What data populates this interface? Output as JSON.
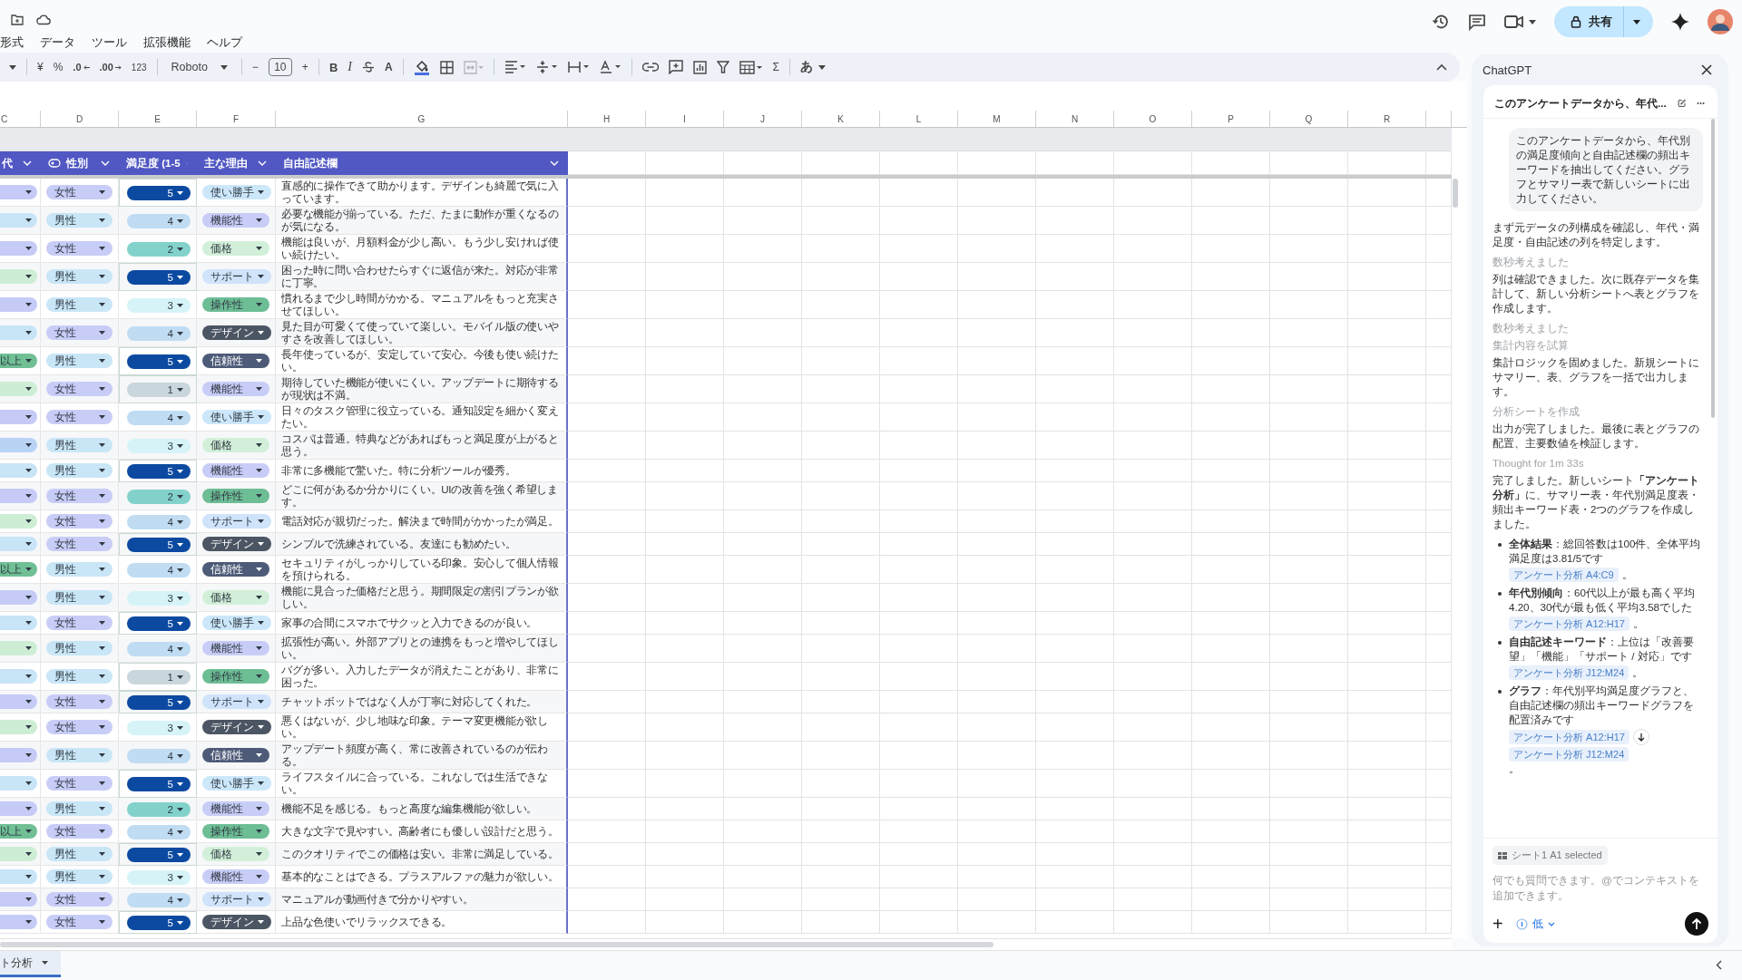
{
  "menu": [
    "形式",
    "データ",
    "ツール",
    "拡張機能",
    "ヘルプ"
  ],
  "toolbar": {
    "currency": "¥",
    "percent": "%",
    "decimal_decrease": ".0",
    "decimal_increase": ".00",
    "number_format": "123",
    "font": "Roboto",
    "font_size_minus": "−",
    "font_size": "10",
    "font_size_plus": "+",
    "bold": "B",
    "italic": "I",
    "text_color": "A",
    "sum": "Σ",
    "input_mode": "あ",
    "merge_disabled": true
  },
  "share": {
    "label": "共有"
  },
  "columns": [
    "C",
    "D",
    "E",
    "F",
    "G",
    "H",
    "I",
    "J",
    "K",
    "L",
    "M",
    "N",
    "O",
    "P",
    "Q",
    "R"
  ],
  "table": {
    "headers": [
      {
        "label": "代",
        "kind": "dropdown"
      },
      {
        "label": "性別",
        "kind": "chip"
      },
      {
        "label": "満足度 (1-5",
        "kind": "dropdown"
      },
      {
        "label": "主な理由",
        "kind": "dropdown"
      },
      {
        "label": "自由記述欄",
        "kind": "dropdown"
      }
    ],
    "rows": [
      {
        "age": {
          "color": "#c5cbf6"
        },
        "gender": {
          "text": "女性",
          "color": "#c8cdf7"
        },
        "score": {
          "text": "5",
          "color": "#0b4aa0",
          "outlined": true
        },
        "reason": {
          "text": "使い勝手",
          "color": "#cce7fa"
        },
        "comment": "直感的に操作できて助かります。デザインも綺麗で気に入っています。"
      },
      {
        "age": {
          "color": "#c8e4f7"
        },
        "gender": {
          "text": "男性",
          "color": "#c9e6f7"
        },
        "score": {
          "text": "4",
          "color": "#c0dcf3",
          "outlined": false
        },
        "reason": {
          "text": "機能性",
          "color": "#c8cdf7"
        },
        "comment": "必要な機能が揃っている。ただ、たまに動作が重くなるのが気になる。"
      },
      {
        "age": {
          "color": "#c5cbf6"
        },
        "gender": {
          "text": "女性",
          "color": "#c8cdf7"
        },
        "score": {
          "text": "2",
          "color": "#82d2cb",
          "outlined": false
        },
        "reason": {
          "text": "価格",
          "color": "#d2f0d9"
        },
        "comment": "機能は良いが、月額料金が少し高い。もう少し安ければ使い続けたい。"
      },
      {
        "age": {
          "color": "#cdeed5"
        },
        "gender": {
          "text": "男性",
          "color": "#c9e6f7"
        },
        "score": {
          "text": "5",
          "color": "#0b4aa0",
          "outlined": true
        },
        "reason": {
          "text": "サポート",
          "color": "#cfe3fa"
        },
        "comment": "困った時に問い合わせたらすぐに返信が来た。対応が非常に丁寧。"
      },
      {
        "age": {
          "color": "#c5cbf6"
        },
        "gender": {
          "text": "男性",
          "color": "#c9e6f7"
        },
        "score": {
          "text": "3",
          "color": "#d6f4f8",
          "outlined": false
        },
        "reason": {
          "text": "操作性",
          "color": "#6dbd95"
        },
        "comment": "慣れるまで少し時間がかかる。マニュアルをもっと充実させてほしい。"
      },
      {
        "age": {
          "color": "#c8e4f7"
        },
        "gender": {
          "text": "女性",
          "color": "#c8cdf7"
        },
        "score": {
          "text": "4",
          "color": "#c0dcf3",
          "outlined": false
        },
        "reason": {
          "text": "デザイン",
          "color": "#4b5563"
        },
        "comment": "見た目が可愛くて使っていて楽しい。モバイル版の使いやすさを改善してほしい。"
      },
      {
        "age": {
          "text": "以上",
          "color": "#70bf95"
        },
        "gender": {
          "text": "男性",
          "color": "#c9e6f7"
        },
        "score": {
          "text": "5",
          "color": "#0b4aa0",
          "outlined": true
        },
        "reason": {
          "text": "信頼性",
          "color": "#4d5b78"
        },
        "comment": "長年使っているが、安定していて安心。今後も使い続けたい。"
      },
      {
        "age": {
          "color": "#cdeed5"
        },
        "gender": {
          "text": "女性",
          "color": "#c8cdf7"
        },
        "score": {
          "text": "1",
          "color": "#c9d6dc",
          "outlined": true
        },
        "reason": {
          "text": "機能性",
          "color": "#c8cdf7"
        },
        "comment": "期待していた機能が使いにくい。アップデートに期待するが現状は不満。"
      },
      {
        "age": {
          "color": "#c5cbf6"
        },
        "gender": {
          "text": "女性",
          "color": "#c8cdf7"
        },
        "score": {
          "text": "4",
          "color": "#c0dcf3",
          "outlined": false
        },
        "reason": {
          "text": "使い勝手",
          "color": "#cce7fa"
        },
        "comment": "日々のタスク管理に役立っている。通知設定を細かく変えたい。"
      },
      {
        "age": {
          "color": "#b9d3f5"
        },
        "gender": {
          "text": "男性",
          "color": "#c9e6f7"
        },
        "score": {
          "text": "3",
          "color": "#d6f4f8",
          "outlined": false
        },
        "reason": {
          "text": "価格",
          "color": "#d2f0d9"
        },
        "comment": "コスパは普通。特典などがあればもっと満足度が上がると思う。"
      },
      {
        "age": {
          "color": "#c8e4f7"
        },
        "gender": {
          "text": "男性",
          "color": "#c9e6f7"
        },
        "score": {
          "text": "5",
          "color": "#0b4aa0",
          "outlined": true
        },
        "reason": {
          "text": "機能性",
          "color": "#c8cdf7"
        },
        "comment": "非常に多機能で驚いた。特に分析ツールが優秀。"
      },
      {
        "age": {
          "color": "#c5cbf6"
        },
        "gender": {
          "text": "女性",
          "color": "#c8cdf7"
        },
        "score": {
          "text": "2",
          "color": "#82d2cb",
          "outlined": false
        },
        "reason": {
          "text": "操作性",
          "color": "#6dbd95"
        },
        "comment": "どこに何があるか分かりにくい。UIの改善を強く希望します。"
      },
      {
        "age": {
          "color": "#cdeed5"
        },
        "gender": {
          "text": "女性",
          "color": "#c8cdf7"
        },
        "score": {
          "text": "4",
          "color": "#c0dcf3",
          "outlined": false
        },
        "reason": {
          "text": "サポート",
          "color": "#cfe3fa"
        },
        "comment": "電話対応が親切だった。解決まで時間がかかったが満足。"
      },
      {
        "age": {
          "color": "#c8e4f7"
        },
        "gender": {
          "text": "女性",
          "color": "#c8cdf7"
        },
        "score": {
          "text": "5",
          "color": "#0b4aa0",
          "outlined": true
        },
        "reason": {
          "text": "デザイン",
          "color": "#4b5563"
        },
        "comment": "シンプルで洗練されている。友達にも勧めたい。"
      },
      {
        "age": {
          "text": "以上",
          "color": "#70bf95"
        },
        "gender": {
          "text": "男性",
          "color": "#c9e6f7"
        },
        "score": {
          "text": "4",
          "color": "#c0dcf3",
          "outlined": false
        },
        "reason": {
          "text": "信頼性",
          "color": "#4d5b78"
        },
        "comment": "セキュリティがしっかりしている印象。安心して個人情報を預けられる。"
      },
      {
        "age": {
          "color": "#c5cbf6"
        },
        "gender": {
          "text": "男性",
          "color": "#c9e6f7"
        },
        "score": {
          "text": "3",
          "color": "#d6f4f8",
          "outlined": false
        },
        "reason": {
          "text": "価格",
          "color": "#d2f0d9"
        },
        "comment": "機能に見合った価格だと思う。期間限定の割引プランが欲しい。"
      },
      {
        "age": {
          "color": "#c8e4f7"
        },
        "gender": {
          "text": "女性",
          "color": "#c8cdf7"
        },
        "score": {
          "text": "5",
          "color": "#0b4aa0",
          "outlined": true
        },
        "reason": {
          "text": "使い勝手",
          "color": "#cce7fa"
        },
        "comment": "家事の合間にスマホでサクッと入力できるのが良い。"
      },
      {
        "age": {
          "color": "#cdeed5"
        },
        "gender": {
          "text": "男性",
          "color": "#c9e6f7"
        },
        "score": {
          "text": "4",
          "color": "#c0dcf3",
          "outlined": false
        },
        "reason": {
          "text": "機能性",
          "color": "#c8cdf7"
        },
        "comment": "拡張性が高い。外部アプリとの連携をもっと増やしてほしい。"
      },
      {
        "age": {
          "color": "#c8e4f7"
        },
        "gender": {
          "text": "男性",
          "color": "#c9e6f7"
        },
        "score": {
          "text": "1",
          "color": "#c9d6dc",
          "outlined": true
        },
        "reason": {
          "text": "操作性",
          "color": "#6dbd95"
        },
        "comment": "バグが多い。入力したデータが消えたことがあり、非常に困った。"
      },
      {
        "age": {
          "color": "#c5cbf6"
        },
        "gender": {
          "text": "女性",
          "color": "#c8cdf7"
        },
        "score": {
          "text": "5",
          "color": "#0b4aa0",
          "outlined": true
        },
        "reason": {
          "text": "サポート",
          "color": "#cfe3fa"
        },
        "comment": "チャットボットではなく人が丁寧に対応してくれた。"
      },
      {
        "age": {
          "color": "#cdeed5"
        },
        "gender": {
          "text": "女性",
          "color": "#c8cdf7"
        },
        "score": {
          "text": "3",
          "color": "#d6f4f8",
          "outlined": false
        },
        "reason": {
          "text": "デザイン",
          "color": "#4b5563"
        },
        "comment": "悪くはないが、少し地味な印象。テーマ変更機能が欲しい。"
      },
      {
        "age": {
          "color": "#c5cbf6"
        },
        "gender": {
          "text": "男性",
          "color": "#c9e6f7"
        },
        "score": {
          "text": "4",
          "color": "#c0dcf3",
          "outlined": false
        },
        "reason": {
          "text": "信頼性",
          "color": "#4d5b78"
        },
        "comment": "アップデート頻度が高く、常に改善されているのが伝わる。"
      },
      {
        "age": {
          "color": "#c8e4f7"
        },
        "gender": {
          "text": "女性",
          "color": "#c8cdf7"
        },
        "score": {
          "text": "5",
          "color": "#0b4aa0",
          "outlined": true
        },
        "reason": {
          "text": "使い勝手",
          "color": "#cce7fa"
        },
        "comment": "ライフスタイルに合っている。これなしでは生活できない。"
      },
      {
        "age": {
          "color": "#c5cbf6"
        },
        "gender": {
          "text": "男性",
          "color": "#c9e6f7"
        },
        "score": {
          "text": "2",
          "color": "#82d2cb",
          "outlined": false
        },
        "reason": {
          "text": "機能性",
          "color": "#c8cdf7"
        },
        "comment": "機能不足を感じる。もっと高度な編集機能が欲しい。"
      },
      {
        "age": {
          "text": "以上",
          "color": "#70bf95"
        },
        "gender": {
          "text": "女性",
          "color": "#c8cdf7"
        },
        "score": {
          "text": "4",
          "color": "#c0dcf3",
          "outlined": false
        },
        "reason": {
          "text": "操作性",
          "color": "#6dbd95"
        },
        "comment": "大きな文字で見やすい。高齢者にも優しい設計だと思う。"
      },
      {
        "age": {
          "color": "#cdeed5"
        },
        "gender": {
          "text": "男性",
          "color": "#c9e6f7"
        },
        "score": {
          "text": "5",
          "color": "#0b4aa0",
          "outlined": true
        },
        "reason": {
          "text": "価格",
          "color": "#d2f0d9"
        },
        "comment": "このクオリティでこの価格は安い。非常に満足している。"
      },
      {
        "age": {
          "color": "#c8e4f7"
        },
        "gender": {
          "text": "男性",
          "color": "#c9e6f7"
        },
        "score": {
          "text": "3",
          "color": "#d6f4f8",
          "outlined": false
        },
        "reason": {
          "text": "機能性",
          "color": "#c8cdf7"
        },
        "comment": "基本的なことはできる。プラスアルファの魅力が欲しい。"
      },
      {
        "age": {
          "color": "#c5cbf6"
        },
        "gender": {
          "text": "女性",
          "color": "#c8cdf7"
        },
        "score": {
          "text": "4",
          "color": "#c0dcf3",
          "outlined": false
        },
        "reason": {
          "text": "サポート",
          "color": "#cfe3fa"
        },
        "comment": "マニュアルが動画付きで分かりやすい。"
      },
      {
        "age": {
          "color": "#c5cbf6"
        },
        "gender": {
          "text": "女性",
          "color": "#c8cdf7"
        },
        "score": {
          "text": "5",
          "color": "#0b4aa0",
          "outlined": true
        },
        "reason": {
          "text": "デザイン",
          "color": "#4b5563"
        },
        "comment": "上品な色使いでリラックスできる。"
      }
    ]
  },
  "sheet_tabs": [
    {
      "label": "ト分析",
      "selected": true
    }
  ],
  "chat": {
    "title": "ChatGPT",
    "thread_title": "このアンケートデータから、年代...",
    "user_message": "このアンケートデータから、年代別の満足度傾向と自由記述欄の頻出キーワードを抽出してください。グラフとサマリー表で新しいシートに出力してください。",
    "items": [
      {
        "kind": "text",
        "text": "まず元データの列構成を確認し、年代・満足度・自由記述の列を特定します。"
      },
      {
        "kind": "status",
        "text": "数秒考えました"
      },
      {
        "kind": "text",
        "text": "列は確認できました。次に既存データを集計して、新しい分析シートへ表とグラフを作成します。"
      },
      {
        "kind": "status",
        "text": "数秒考えました"
      },
      {
        "kind": "status",
        "text": "集計内容を試算"
      },
      {
        "kind": "text",
        "text": "集計ロジックを固めました。新規シートにサマリー、表、グラフを一括で出力します。"
      },
      {
        "kind": "status",
        "text": "分析シートを作成"
      },
      {
        "kind": "text",
        "text": "出力が完了しました。最後に表とグラフの配置、主要数値を検証します。"
      },
      {
        "kind": "status",
        "text": "Thought for 1m 33s"
      },
      {
        "kind": "text",
        "text": "完了しました。新しいシート**「アンケート分析」**に、サマリー表・年代別満足度表・頻出キーワード表・2つのグラフを作成しました。"
      }
    ],
    "bullets": [
      {
        "text": "**全体結果**：総回答数は100件、全体平均満足度は3.81/5です",
        "refs": [
          "アンケート分析 A4:C9"
        ],
        "end": "。"
      },
      {
        "text": "**年代別傾向**：60代以上が最も高く平均4.20、30代が最も低く平均3.58でした",
        "refs": [
          "アンケート分析 A12:H17"
        ],
        "end": "。"
      },
      {
        "text": "**自由記述キーワード**：上位は「改善要望」「機能」「サポート / 対応」です",
        "refs": [
          "アンケート分析 J12:M24"
        ],
        "end": "。"
      },
      {
        "text": "**グラフ**：年代別平均満足度グラフと、自由記述欄の頻出キーワードグラフを配置済みです",
        "refs": [
          "アンケート分析 A12:H17",
          "アンケート分析 J12:M24"
        ],
        "end": "。"
      }
    ],
    "context_chip": "シート1 A1 selected",
    "placeholder": "何でも質問できます。@でコンテキストを追加できます。",
    "add": "+",
    "effort": "低"
  }
}
